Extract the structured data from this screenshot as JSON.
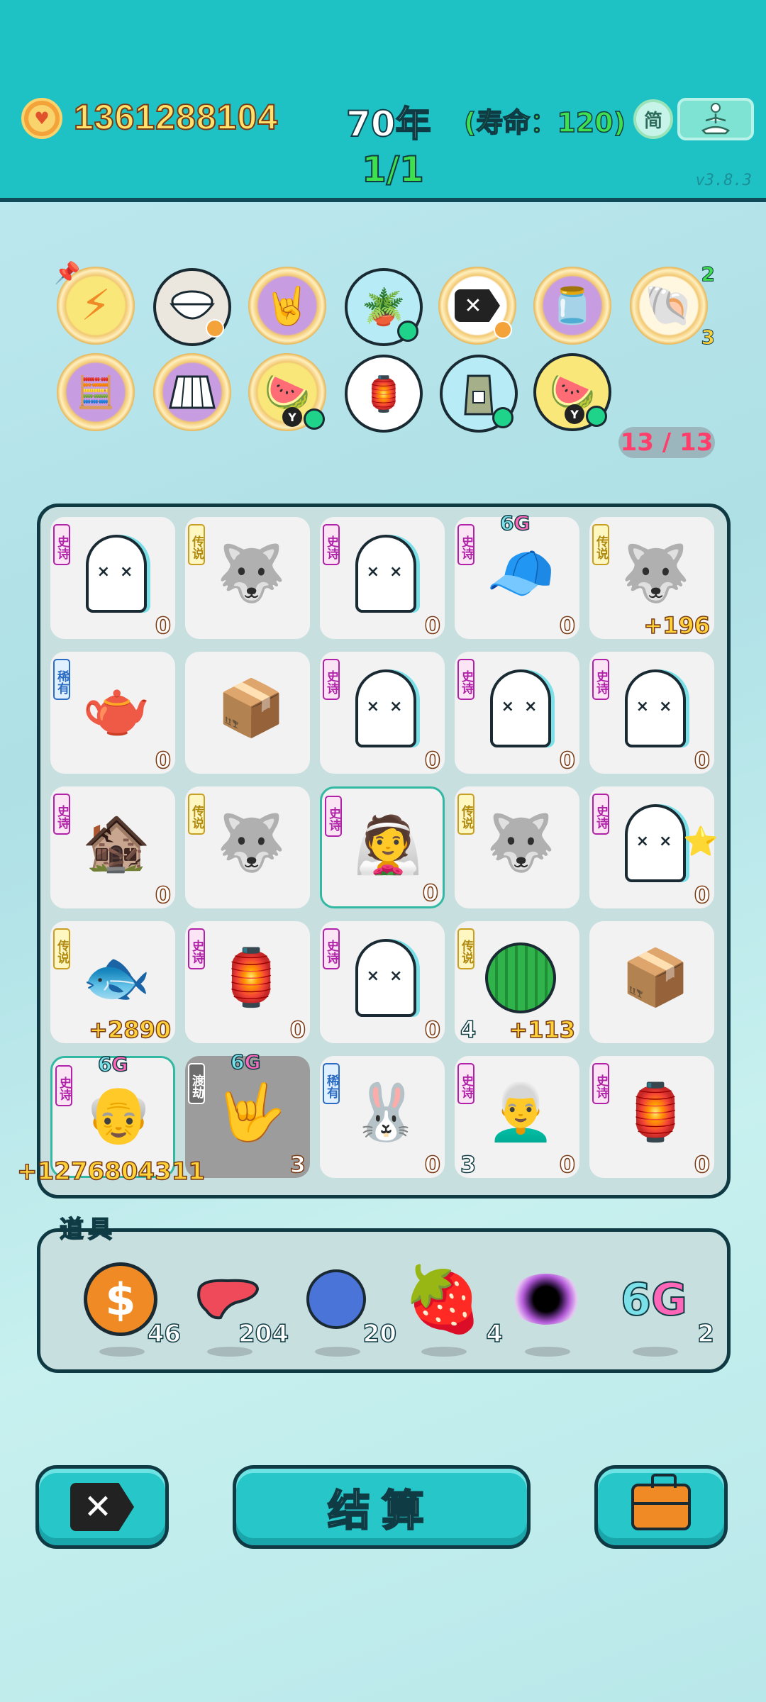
{
  "header": {
    "money": "1361288104",
    "year": "70年",
    "lifespan": "(寿命：120)",
    "simple_label": "简",
    "round": "1/1",
    "version": "v3.8.3"
  },
  "buffs": {
    "counter": "13 / 13",
    "shell_stack_top": "2",
    "shell_stack_bottom": "3",
    "icons": [
      "lightning-icon",
      "rice-bowl-icon",
      "rock-hand-icon",
      "potted-flower-icon",
      "delete-tag-icon",
      "honey-jar-icon",
      "shell-icon",
      "math-boy-icon",
      "skirt-icon",
      "fruit-bowl-icon",
      "ghost-lantern-icon",
      "sack-icon",
      "fruit-bowl-icon"
    ]
  },
  "grid": {
    "cells": [
      {
        "rarity": "史诗",
        "label": "ghost",
        "value": "0"
      },
      {
        "rarity": "传说",
        "label": "husky",
        "value": ""
      },
      {
        "rarity": "史诗",
        "label": "ghost",
        "value": "0"
      },
      {
        "rarity": "史诗",
        "label": "green-hat-man",
        "sixg": "6G",
        "value": "0"
      },
      {
        "rarity": "传说",
        "label": "husky",
        "value": "+196"
      },
      {
        "rarity": "稀有",
        "label": "teapot",
        "value": "0"
      },
      {
        "rarity": "",
        "label": "box",
        "value": ""
      },
      {
        "rarity": "史诗",
        "label": "ghost",
        "value": "0"
      },
      {
        "rarity": "史诗",
        "label": "ghost",
        "value": "0"
      },
      {
        "rarity": "史诗",
        "label": "ghost",
        "value": "0"
      },
      {
        "rarity": "史诗",
        "label": "haunted-house",
        "value": "0"
      },
      {
        "rarity": "传说",
        "label": "husky",
        "value": ""
      },
      {
        "rarity": "史诗",
        "label": "bride",
        "value": "0"
      },
      {
        "rarity": "传说",
        "label": "husky",
        "value": ""
      },
      {
        "rarity": "史诗",
        "label": "ghost-star",
        "value": "0"
      },
      {
        "rarity": "传说",
        "label": "koi",
        "value": "+2890"
      },
      {
        "rarity": "史诗",
        "label": "rabbit-house",
        "value": "0"
      },
      {
        "rarity": "史诗",
        "label": "ghost",
        "value": "0"
      },
      {
        "rarity": "传说",
        "label": "watermelon",
        "left": "4",
        "value": "+113"
      },
      {
        "rarity": "",
        "label": "box",
        "value": ""
      },
      {
        "rarity": "史诗",
        "label": "bald-man",
        "sixg": "6G",
        "value": ""
      },
      {
        "rarity": "渡劫",
        "label": "yellow-hand",
        "sixg": "6G",
        "value": "3"
      },
      {
        "rarity": "稀有",
        "label": "rabbit",
        "value": "0"
      },
      {
        "rarity": "史诗",
        "label": "old-man",
        "left": "3",
        "value": "0"
      },
      {
        "rarity": "史诗",
        "label": "rabbit-house",
        "value": "0"
      }
    ],
    "overflow_value": "+1276804311"
  },
  "items": {
    "title": "道具",
    "list": [
      {
        "name": "coin",
        "count": "46"
      },
      {
        "name": "liver",
        "count": "204"
      },
      {
        "name": "blueberry",
        "count": "20"
      },
      {
        "name": "strawberry",
        "count": "4"
      },
      {
        "name": "black-hole",
        "count": ""
      },
      {
        "name": "6g",
        "count": "2",
        "text": "6G"
      }
    ]
  },
  "buttons": {
    "settle": "结算"
  },
  "colors": {
    "header_bg": "#1fc2c4",
    "board_bg": "#c8dfe0",
    "button_bg": "#27c6c8"
  }
}
